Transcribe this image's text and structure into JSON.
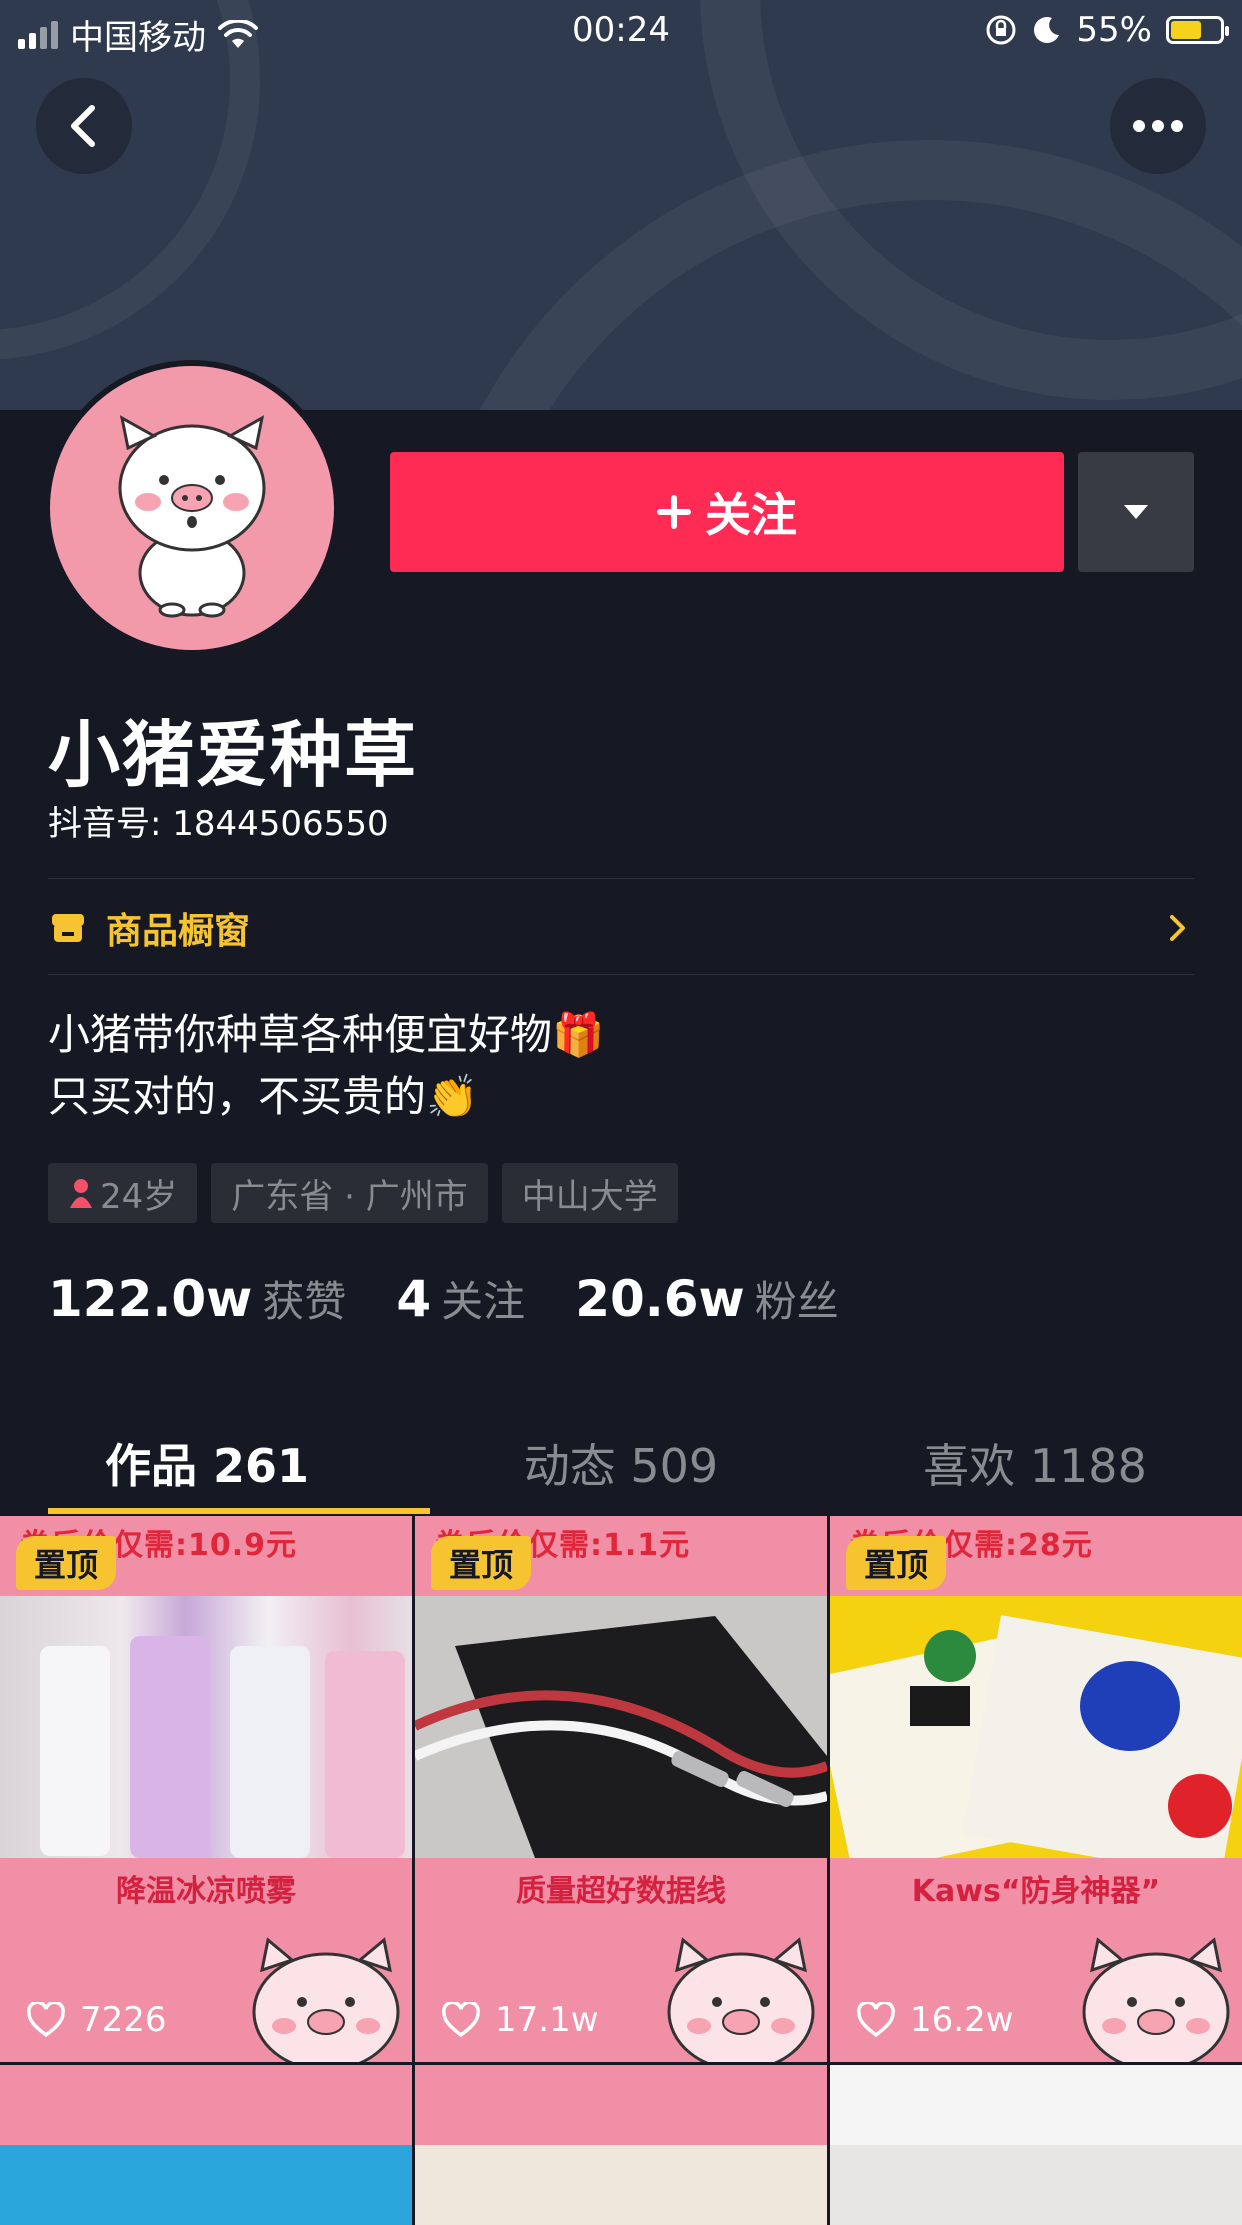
{
  "status_bar": {
    "carrier": "中国移动",
    "time": "00:24",
    "battery": "55%"
  },
  "profile": {
    "name": "小猪爱种草",
    "douyin_id": "抖音号: 1844506550",
    "follow_label": "关注",
    "shop_label": "商品橱窗",
    "bio_line1": "小猪带你种草各种便宜好物🎁",
    "bio_line2": "只买对的，不买贵的👏",
    "tags": [
      "24岁",
      "广东省 · 广州市",
      "中山大学"
    ],
    "stats": [
      {
        "value": "122.0w",
        "label": "获赞"
      },
      {
        "value": "4",
        "label": "关注"
      },
      {
        "value": "20.6w",
        "label": "粉丝"
      }
    ]
  },
  "tabs": [
    {
      "label": "作品 261"
    },
    {
      "label": "动态 509"
    },
    {
      "label": "喜欢 1188"
    }
  ],
  "videos": [
    {
      "pin": "置顶",
      "price": "券后价仅需:10.9元",
      "caption": "降温冰凉喷雾",
      "likes": "7226"
    },
    {
      "pin": "置顶",
      "price": "券后价仅需:1.1元",
      "caption": "质量超好数据线",
      "likes": "17.1w"
    },
    {
      "pin": "置顶",
      "price": "券后价仅需:28元",
      "caption": "Kaws“防身神器”",
      "likes": "16.2w"
    }
  ],
  "colors": {
    "accent": "#fe2c55",
    "gold": "#f6c431",
    "bg": "#161823"
  }
}
